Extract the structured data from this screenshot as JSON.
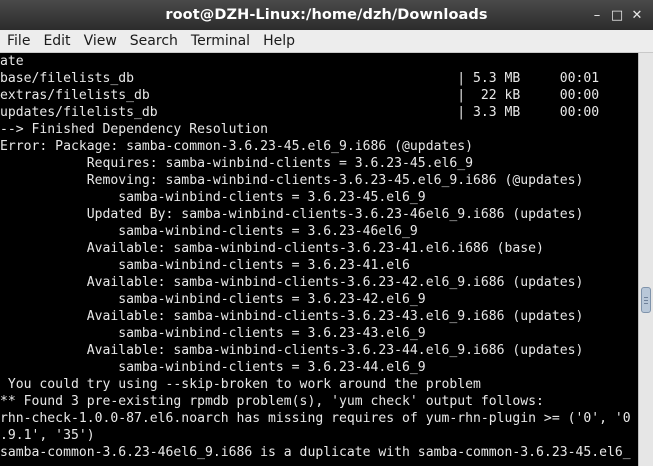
{
  "window": {
    "title": "root@DZH-Linux:/home/dzh/Downloads",
    "controls": {
      "minimize": "–",
      "maximize": "□",
      "close": "✕"
    }
  },
  "menu": [
    "File",
    "Edit",
    "View",
    "Search",
    "Terminal",
    "Help"
  ],
  "terminal": {
    "lines": [
      "ate",
      "base/filelists_db                                         | 5.3 MB     00:01",
      "extras/filelists_db                                       |  22 kB     00:00",
      "updates/filelists_db                                      | 3.3 MB     00:00",
      "--> Finished Dependency Resolution",
      "Error: Package: samba-common-3.6.23-45.el6_9.i686 (@updates)",
      "           Requires: samba-winbind-clients = 3.6.23-45.el6_9",
      "           Removing: samba-winbind-clients-3.6.23-45.el6_9.i686 (@updates)",
      "               samba-winbind-clients = 3.6.23-45.el6_9",
      "           Updated By: samba-winbind-clients-3.6.23-46el6_9.i686 (updates)",
      "               samba-winbind-clients = 3.6.23-46el6_9",
      "           Available: samba-winbind-clients-3.6.23-41.el6.i686 (base)",
      "               samba-winbind-clients = 3.6.23-41.el6",
      "           Available: samba-winbind-clients-3.6.23-42.el6_9.i686 (updates)",
      "               samba-winbind-clients = 3.6.23-42.el6_9",
      "           Available: samba-winbind-clients-3.6.23-43.el6_9.i686 (updates)",
      "               samba-winbind-clients = 3.6.23-43.el6_9",
      "           Available: samba-winbind-clients-3.6.23-44.el6_9.i686 (updates)",
      "               samba-winbind-clients = 3.6.23-44.el6_9",
      " You could try using --skip-broken to work around the problem",
      "** Found 3 pre-existing rpmdb problem(s), 'yum check' output follows:",
      "rhn-check-1.0.0-87.el6.noarch has missing requires of yum-rhn-plugin >= ('0', '0",
      ".9.1', '35')",
      "samba-common-3.6.23-46el6_9.i686 is a duplicate with samba-common-3.6.23-45.el6_"
    ]
  }
}
